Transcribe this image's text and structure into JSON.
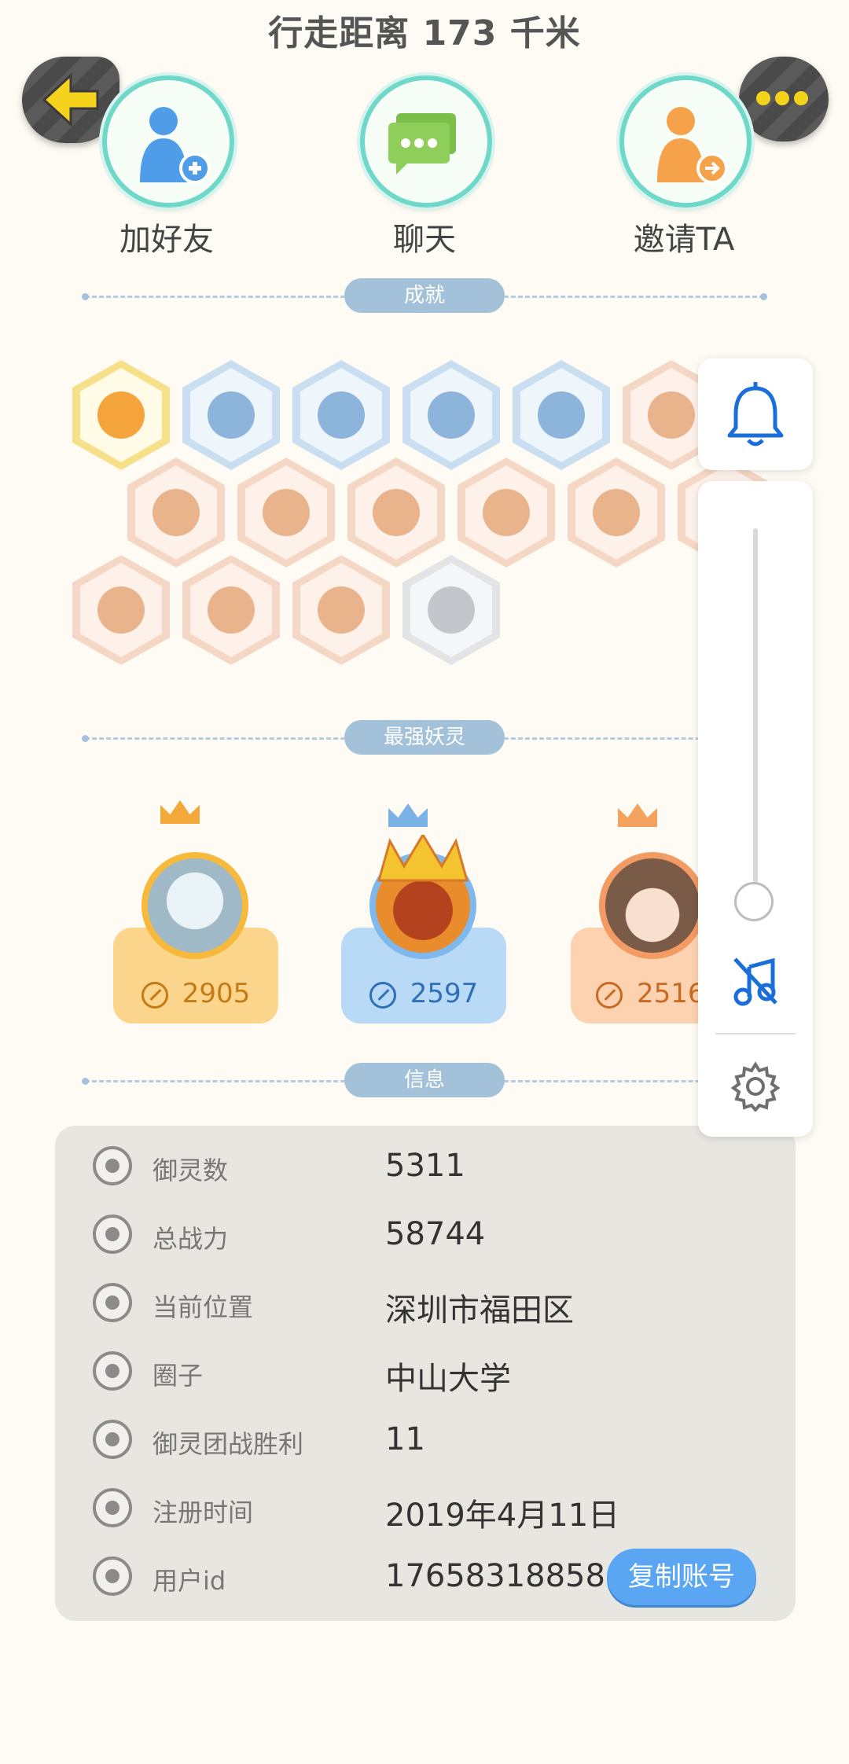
{
  "header": {
    "distance_text": "行走距离 173 千米"
  },
  "actions": [
    {
      "label": "加好友",
      "icon": "add-friend-icon"
    },
    {
      "label": "聊天",
      "icon": "chat-icon"
    },
    {
      "label": "邀请TA",
      "icon": "invite-icon"
    }
  ],
  "sections": {
    "achievements": "成就",
    "strongest": "最强妖灵",
    "info": "信息"
  },
  "strongest": [
    {
      "power": "2905",
      "crown_color": "#f3a83a",
      "card_color": "#fbd58c",
      "text_color": "#c47a15"
    },
    {
      "power": "2597",
      "crown_color": "#7cb3e7",
      "card_color": "#b9daf6",
      "text_color": "#2f6fb8"
    },
    {
      "power": "2516",
      "crown_color": "#f3a35d",
      "card_color": "#fdd2b0",
      "text_color": "#c96a22"
    }
  ],
  "info": {
    "rows": [
      {
        "key": "御灵数",
        "value": "5311",
        "icon": "spirit-count-icon"
      },
      {
        "key": "总战力",
        "value": "58744",
        "icon": "sword-icon"
      },
      {
        "key": "当前位置",
        "value": "深圳市福田区",
        "icon": "location-pin-icon"
      },
      {
        "key": "圈子",
        "value": "中山大学",
        "icon": "circle-icon"
      },
      {
        "key": "御灵团战胜利",
        "value": "11",
        "icon": "team-battle-icon"
      },
      {
        "key": "注册时间",
        "value": "2019年4月11日",
        "icon": "clock-icon"
      },
      {
        "key": "用户id",
        "value": "17658318858",
        "icon": "user-id-icon"
      }
    ],
    "copy_button": "复制账号"
  },
  "colors": {
    "background": "#fdfbf3",
    "ring": "#6fd8c9",
    "section_pill": "#a3c2d9",
    "copy_button": "#5aa6f2",
    "control_blue": "#1a6ed8"
  }
}
